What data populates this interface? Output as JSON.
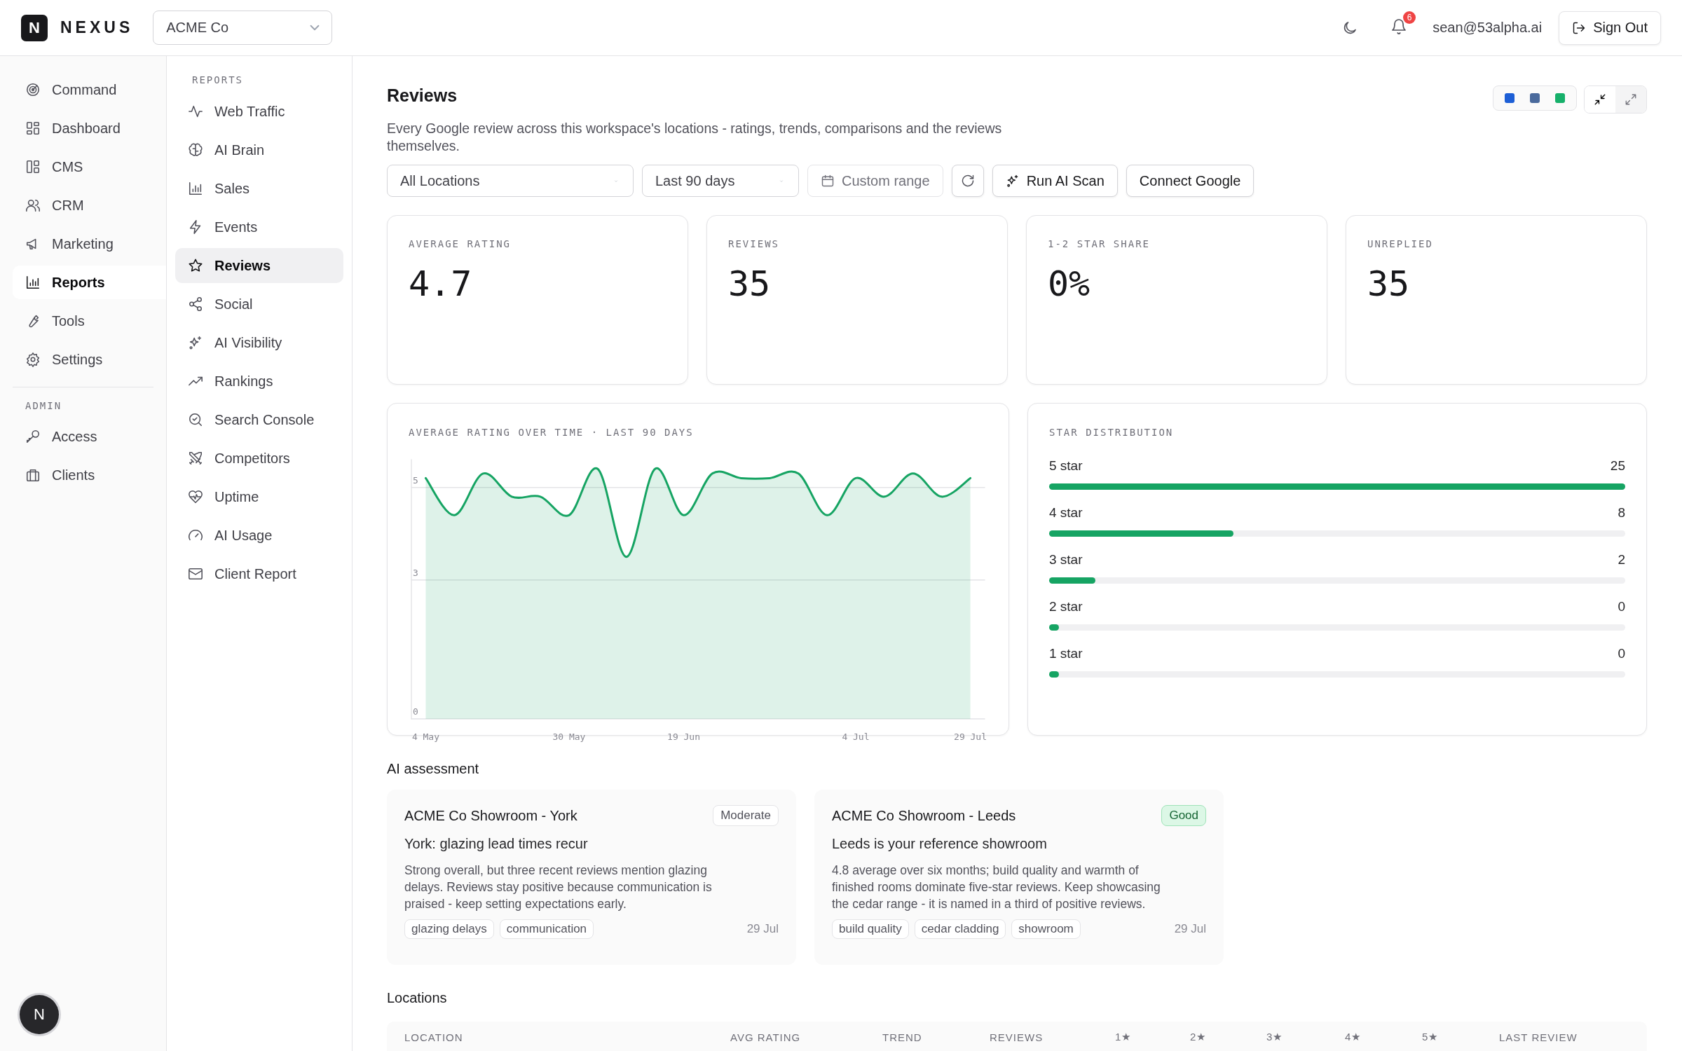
{
  "brand": {
    "logo": "N",
    "name": "NEXUS"
  },
  "org_select": {
    "value": "ACME Co"
  },
  "header": {
    "notifications": "6",
    "user": "sean@53alpha.ai",
    "sign_out": "Sign Out"
  },
  "main_nav": [
    {
      "label": "Command",
      "selected": false
    },
    {
      "label": "Dashboard",
      "selected": false
    },
    {
      "label": "CMS",
      "selected": false
    },
    {
      "label": "CRM",
      "selected": false
    },
    {
      "label": "Marketing",
      "selected": false
    },
    {
      "label": "Reports",
      "selected": true
    },
    {
      "label": "Tools",
      "selected": false
    },
    {
      "label": "Settings",
      "selected": false
    }
  ],
  "admin_nav": {
    "heading": "ADMIN",
    "items": [
      {
        "label": "Access",
        "selected": false
      },
      {
        "label": "Clients",
        "selected": false
      }
    ]
  },
  "avatar": "N",
  "reports_nav": {
    "heading": "REPORTS",
    "items": [
      {
        "label": "Web Traffic",
        "selected": false
      },
      {
        "label": "AI Brain",
        "selected": false
      },
      {
        "label": "Sales",
        "selected": false
      },
      {
        "label": "Events",
        "selected": false
      },
      {
        "label": "Reviews",
        "selected": true
      },
      {
        "label": "Social",
        "selected": false
      },
      {
        "label": "AI Visibility",
        "selected": false
      },
      {
        "label": "Rankings",
        "selected": false
      },
      {
        "label": "Search Console",
        "selected": false
      },
      {
        "label": "Competitors",
        "selected": false
      },
      {
        "label": "Uptime",
        "selected": false
      },
      {
        "label": "AI Usage",
        "selected": false
      },
      {
        "label": "Client Report",
        "selected": false
      }
    ]
  },
  "page": {
    "title": "Reviews",
    "description": "Every Google review across this workspace's locations - ratings, trends, comparisons and the reviews themselves."
  },
  "theme_swatches": [
    {
      "color": "#1d5fd6"
    },
    {
      "color": "#4a6a9c"
    },
    {
      "color": "#16b06a"
    }
  ],
  "layout_buttons": [
    {
      "selected": false
    },
    {
      "selected": true
    }
  ],
  "filters": {
    "location": "All Locations",
    "period": "Last 90 days",
    "custom_range": "Custom range",
    "run_scan": "Run AI Scan",
    "connect": "Connect Google"
  },
  "stats": [
    {
      "label": "AVERAGE RATING",
      "value": "4.7"
    },
    {
      "label": "REVIEWS",
      "value": "35"
    },
    {
      "label": "1-2 STAR SHARE",
      "value": "0%"
    },
    {
      "label": "UNREPLIED",
      "value": "35"
    }
  ],
  "rating_chart": {
    "title": "AVERAGE RATING OVER TIME · LAST 90 DAYS",
    "chart_data": {
      "type": "line",
      "categories": [
        "4 May",
        null,
        null,
        null,
        null,
        "30 May",
        null,
        null,
        null,
        "19 Jun",
        null,
        null,
        null,
        null,
        null,
        "4 Jul",
        null,
        null,
        null,
        "29 Jul"
      ],
      "series": [
        {
          "color": "#16a463",
          "values": [
            5.2,
            4.4,
            5.3,
            4.8,
            4.8,
            4.4,
            5.4,
            3.5,
            5.4,
            4.4,
            5.3,
            5.2,
            5.2,
            5.3,
            4.4,
            5.2,
            4.8,
            5.3,
            4.8,
            5.2
          ]
        }
      ],
      "ylim": [
        0,
        5.6
      ],
      "yticks": [
        0,
        3,
        5
      ]
    }
  },
  "star_distribution": {
    "title": "STAR DISTRIBUTION",
    "rows": [
      {
        "label": "5 star",
        "count": "25",
        "level": 1
      },
      {
        "label": "4 star",
        "count": "8",
        "level": 0.32
      },
      {
        "label": "3 star",
        "count": "2",
        "level": 0.08
      },
      {
        "label": "2 star",
        "count": "0",
        "level": 0
      },
      {
        "label": "1 star",
        "count": "0",
        "level": 0
      }
    ]
  },
  "ai_assessment": {
    "heading": "AI assessment",
    "cards": [
      {
        "location": "ACME Co Showroom - York",
        "rating": "Moderate",
        "kind": "neutral",
        "headline": "York: glazing lead times recur",
        "body": "Strong overall, but three recent reviews mention glazing delays. Reviews stay positive because communication is praised - keep setting expectations early.",
        "tags": [
          "glazing delays",
          "communication"
        ],
        "date": "29 Jul"
      },
      {
        "location": "ACME Co Showroom - Leeds",
        "rating": "Good",
        "kind": "positive",
        "headline": "Leeds is your reference showroom",
        "body": "4.8 average over six months; build quality and warmth of finished rooms dominate five-star reviews. Keep showcasing the cedar range - it is named in a third of positive reviews.",
        "tags": [
          "build quality",
          "cedar cladding",
          "showroom"
        ],
        "date": "29 Jul"
      }
    ]
  },
  "locations": {
    "heading": "Locations",
    "columns": [
      "LOCATION",
      "AVG RATING",
      "TREND",
      "REVIEWS",
      "1★",
      "2★",
      "3★",
      "4★",
      "5★",
      "LAST REVIEW"
    ]
  }
}
